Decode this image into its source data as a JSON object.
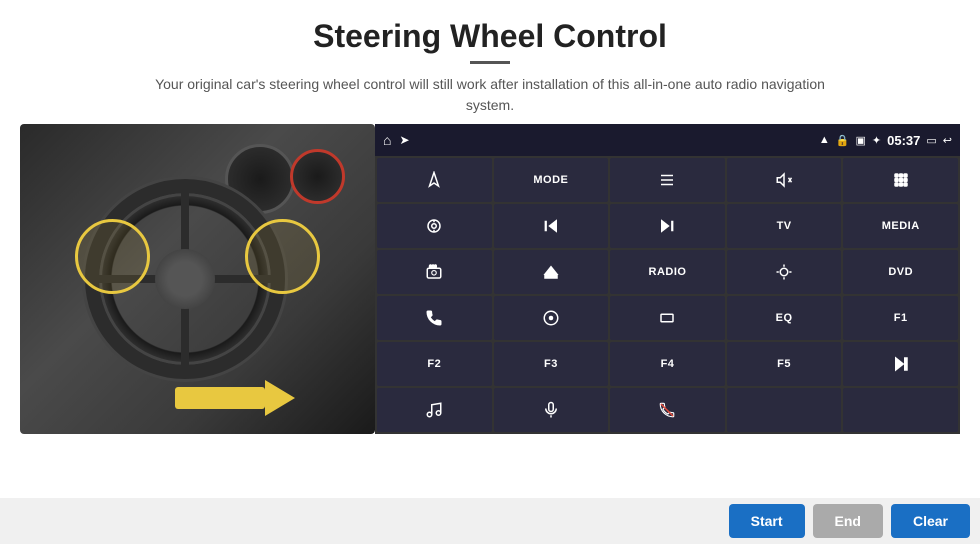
{
  "header": {
    "title": "Steering Wheel Control",
    "divider": true,
    "subtitle": "Your original car's steering wheel control will still work after installation of this all-in-one auto radio navigation system."
  },
  "status_bar": {
    "time": "05:37",
    "icons": [
      "home",
      "wifi",
      "lock",
      "sd",
      "bluetooth",
      "battery",
      "screen",
      "back"
    ]
  },
  "grid_buttons": [
    {
      "label": "",
      "icon": "navigate",
      "row": 1,
      "col": 1
    },
    {
      "label": "MODE",
      "icon": null,
      "row": 1,
      "col": 2
    },
    {
      "label": "",
      "icon": "list",
      "row": 1,
      "col": 3
    },
    {
      "label": "",
      "icon": "mute",
      "row": 1,
      "col": 4
    },
    {
      "label": "",
      "icon": "apps",
      "row": 1,
      "col": 5
    },
    {
      "label": "",
      "icon": "settings-circle",
      "row": 2,
      "col": 1
    },
    {
      "label": "",
      "icon": "prev",
      "row": 2,
      "col": 2
    },
    {
      "label": "",
      "icon": "next",
      "row": 2,
      "col": 3
    },
    {
      "label": "TV",
      "icon": null,
      "row": 2,
      "col": 4
    },
    {
      "label": "MEDIA",
      "icon": null,
      "row": 2,
      "col": 5
    },
    {
      "label": "",
      "icon": "camera-360",
      "row": 3,
      "col": 1
    },
    {
      "label": "",
      "icon": "eject",
      "row": 3,
      "col": 2
    },
    {
      "label": "RADIO",
      "icon": null,
      "row": 3,
      "col": 3
    },
    {
      "label": "",
      "icon": "brightness",
      "row": 3,
      "col": 4
    },
    {
      "label": "DVD",
      "icon": null,
      "row": 3,
      "col": 5
    },
    {
      "label": "",
      "icon": "phone",
      "row": 4,
      "col": 1
    },
    {
      "label": "",
      "icon": "compass",
      "row": 4,
      "col": 2
    },
    {
      "label": "",
      "icon": "rectangle",
      "row": 4,
      "col": 3
    },
    {
      "label": "EQ",
      "icon": null,
      "row": 4,
      "col": 4
    },
    {
      "label": "F1",
      "icon": null,
      "row": 4,
      "col": 5
    },
    {
      "label": "F2",
      "icon": null,
      "row": 5,
      "col": 1
    },
    {
      "label": "F3",
      "icon": null,
      "row": 5,
      "col": 2
    },
    {
      "label": "F4",
      "icon": null,
      "row": 5,
      "col": 3
    },
    {
      "label": "F5",
      "icon": null,
      "row": 5,
      "col": 4
    },
    {
      "label": "",
      "icon": "play-pause",
      "row": 5,
      "col": 5
    },
    {
      "label": "",
      "icon": "music",
      "row": 6,
      "col": 1
    },
    {
      "label": "",
      "icon": "mic",
      "row": 6,
      "col": 2
    },
    {
      "label": "",
      "icon": "phone-end",
      "row": 6,
      "col": 3
    },
    {
      "label": "",
      "icon": null,
      "row": 6,
      "col": 4
    },
    {
      "label": "",
      "icon": null,
      "row": 6,
      "col": 5
    }
  ],
  "bottom_bar": {
    "start_label": "Start",
    "end_label": "End",
    "clear_label": "Clear"
  }
}
